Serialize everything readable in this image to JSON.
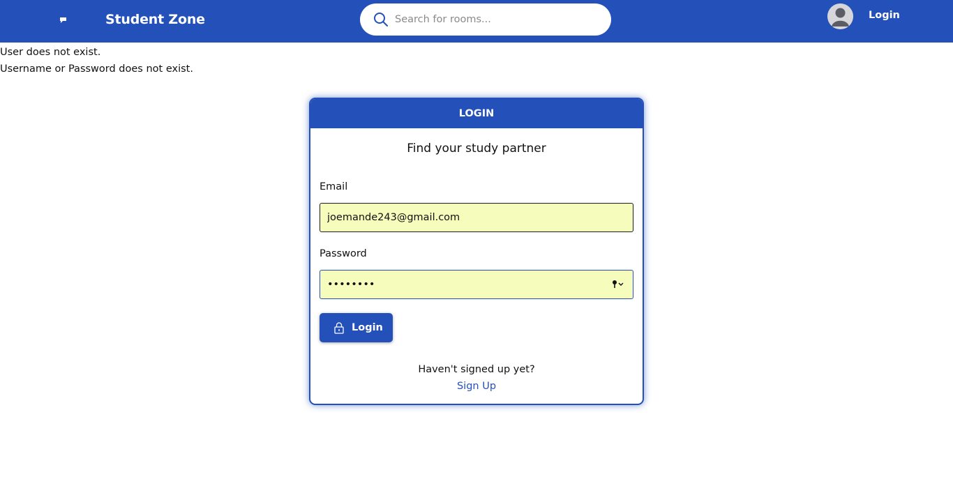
{
  "header": {
    "logo_icon": "chat-bubble-icon",
    "brand": "Student Zone",
    "search": {
      "icon": "search-icon",
      "placeholder": "Search for rooms..."
    },
    "avatar_icon": "user-avatar-icon",
    "login_link": "Login"
  },
  "messages": [
    "User does not exist.",
    "Username or Password does not exist."
  ],
  "login_card": {
    "header": "LOGIN",
    "subtitle": "Find your study partner",
    "email": {
      "label": "Email",
      "value": "joemande243@gmail.com"
    },
    "password": {
      "label": "Password",
      "value": "password",
      "icon": "key-icon"
    },
    "button": {
      "icon": "lock-icon",
      "label": "Login"
    },
    "signup_prompt": "Haven't signed up yet?",
    "signup_link": "Sign Up"
  },
  "colors": {
    "primary": "#2350b9",
    "autofill_bg": "#f5fcbc"
  }
}
